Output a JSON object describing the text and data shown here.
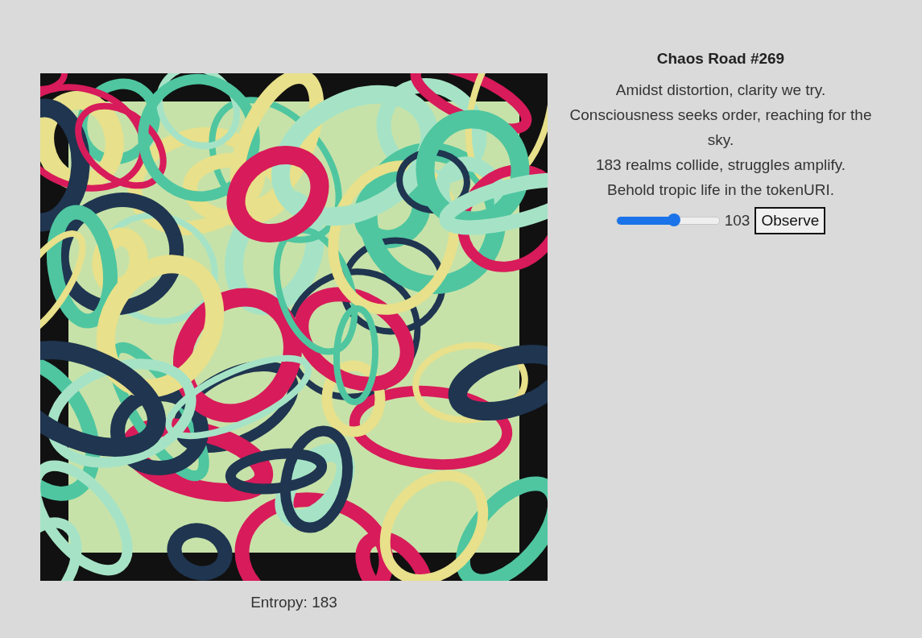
{
  "artwork": {
    "caption": "Entropy: 183"
  },
  "title": "Chaos Road #269",
  "poem": [
    "Amidst distortion, clarity we try.",
    "Consciousness seeks order, reaching for the sky.",
    "183 realms collide, struggles amplify.",
    "Behold tropic life in the tokenURI."
  ],
  "slider": {
    "level": 0.56,
    "reading": "103"
  },
  "button": "Observe"
}
